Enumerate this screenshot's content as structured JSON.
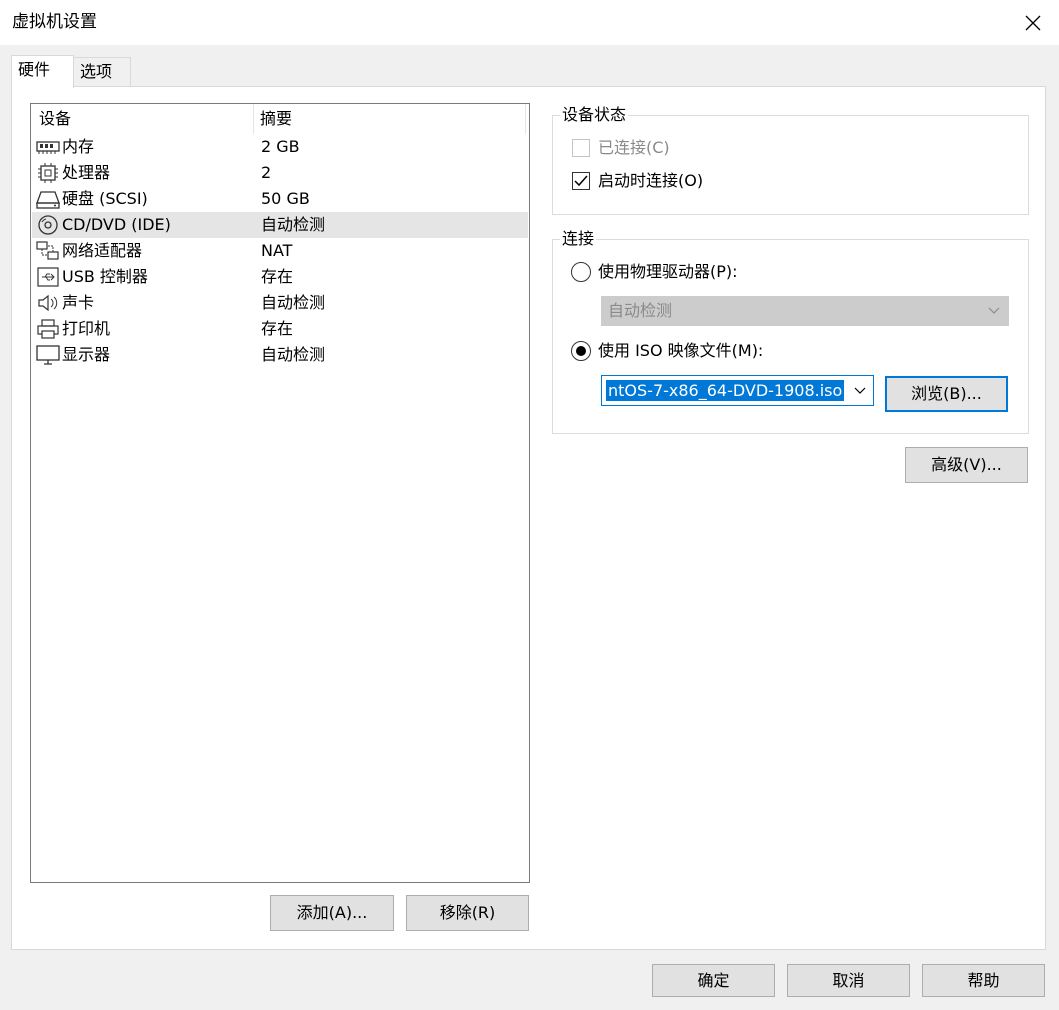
{
  "window": {
    "title": "虚拟机设置"
  },
  "tabs": [
    {
      "label": "硬件"
    },
    {
      "label": "选项"
    }
  ],
  "device_list": {
    "headers": {
      "device": "设备",
      "summary": "摘要"
    },
    "rows": [
      {
        "name": "内存",
        "summary": "2 GB",
        "icon": "memory-icon"
      },
      {
        "name": "处理器",
        "summary": "2",
        "icon": "processor-icon"
      },
      {
        "name": "硬盘 (SCSI)",
        "summary": "50 GB",
        "icon": "hard-disk-icon"
      },
      {
        "name": "CD/DVD (IDE)",
        "summary": "自动检测",
        "icon": "cd-dvd-icon",
        "selected": true
      },
      {
        "name": "网络适配器",
        "summary": "NAT",
        "icon": "network-adapter-icon"
      },
      {
        "name": "USB 控制器",
        "summary": "存在",
        "icon": "usb-icon"
      },
      {
        "name": "声卡",
        "summary": "自动检测",
        "icon": "sound-card-icon"
      },
      {
        "name": "打印机",
        "summary": "存在",
        "icon": "printer-icon"
      },
      {
        "name": "显示器",
        "summary": "自动检测",
        "icon": "display-icon"
      }
    ]
  },
  "device_buttons": {
    "add": "添加(A)...",
    "remove": "移除(R)"
  },
  "device_status": {
    "legend": "设备状态",
    "connected": {
      "label": "已连接(C)",
      "checked": false,
      "disabled": true
    },
    "connect_at_power_on": {
      "label": "启动时连接(O)",
      "checked": true
    }
  },
  "connection": {
    "legend": "连接",
    "physical": {
      "label": "使用物理驱动器(P):",
      "selected": false,
      "select_value": "自动检测"
    },
    "iso": {
      "label": "使用 ISO 映像文件(M):",
      "selected": true,
      "value": "ntOS-7-x86_64-DVD-1908.iso"
    },
    "browse": "浏览(B)..."
  },
  "advanced": "高级(V)...",
  "footer": {
    "ok": "确定",
    "cancel": "取消",
    "help": "帮助"
  }
}
